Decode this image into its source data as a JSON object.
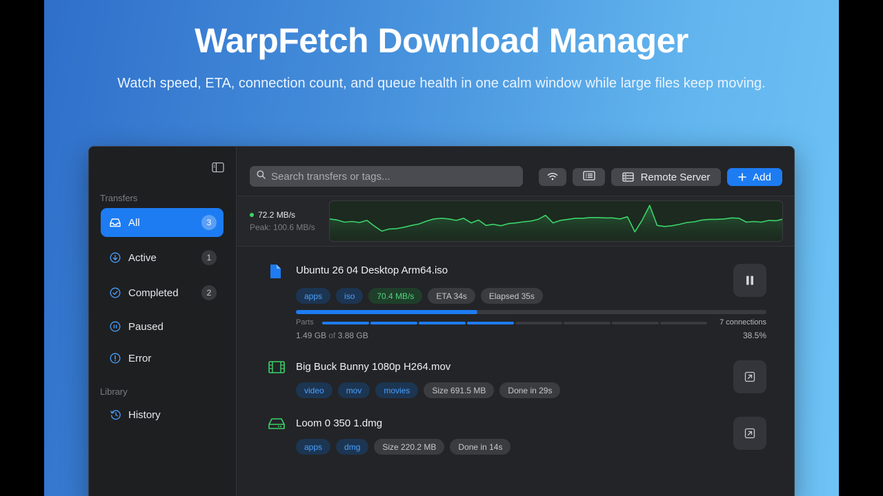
{
  "hero": {
    "title": "WarpFetch Download Manager",
    "subtitle": "Watch speed, ETA, connection count, and queue health in one calm window while large files keep moving."
  },
  "sidebar": {
    "section_transfers": "Transfers",
    "section_library": "Library",
    "items": [
      {
        "label": "All",
        "count": "3",
        "icon": "inbox-icon",
        "selected": true
      },
      {
        "label": "Active",
        "count": "1",
        "icon": "download-circle-icon"
      },
      {
        "label": "Completed",
        "count": "2",
        "icon": "check-circle-icon"
      },
      {
        "label": "Paused",
        "count": "",
        "icon": "pause-circle-icon"
      },
      {
        "label": "Error",
        "count": "",
        "icon": "alert-circle-icon"
      }
    ],
    "library_items": [
      {
        "label": "History",
        "icon": "history-icon"
      }
    ]
  },
  "toolbar": {
    "search_placeholder": "Search transfers or tags...",
    "remote_label": "Remote Server",
    "add_label": "Add"
  },
  "speed": {
    "current": "72.2 MB/s",
    "peak": "Peak: 100.6 MB/s",
    "accent": "#3bd46a",
    "history": [
      58,
      55,
      49,
      51,
      48,
      54,
      38,
      24,
      30,
      31,
      35,
      40,
      44,
      52,
      58,
      60,
      58,
      54,
      60,
      47,
      55,
      40,
      43,
      39,
      45,
      47,
      50,
      52,
      57,
      68,
      47,
      54,
      57,
      60,
      60,
      62,
      62,
      61,
      61,
      58,
      64,
      22,
      55,
      96,
      40,
      37,
      39,
      43,
      48,
      50,
      55,
      57,
      57,
      58,
      61,
      60,
      49,
      51,
      49,
      54,
      53,
      58
    ]
  },
  "transfers": [
    {
      "name": "Ubuntu 26 04 Desktop Arm64.iso",
      "icon": "document-icon",
      "tags": [
        {
          "text": "apps",
          "kind": "blue"
        },
        {
          "text": "iso",
          "kind": "blue"
        },
        {
          "text": "70.4 MB/s",
          "kind": "green"
        },
        {
          "text": "ETA 34s",
          "kind": "gray"
        },
        {
          "text": "Elapsed 35s",
          "kind": "gray"
        }
      ],
      "progress": 0.385,
      "parts_label": "Parts",
      "parts_progress": [
        1,
        1,
        1,
        1,
        0,
        0,
        0,
        0
      ],
      "connections": "7 connections",
      "downloaded": "1.49 GB",
      "of_label": "of",
      "total": "3.88 GB",
      "percent": "38.5%",
      "action": "pause-icon"
    },
    {
      "name": "Big Buck Bunny 1080p H264.mov",
      "icon": "film-icon",
      "tags": [
        {
          "text": "video",
          "kind": "blue"
        },
        {
          "text": "mov",
          "kind": "blue"
        },
        {
          "text": "movies",
          "kind": "blue"
        },
        {
          "text": "Size 691.5 MB",
          "kind": "gray"
        },
        {
          "text": "Done in 29s",
          "kind": "gray"
        }
      ],
      "action": "open-external-icon"
    },
    {
      "name": "Loom 0 350 1.dmg",
      "icon": "drive-icon",
      "tags": [
        {
          "text": "apps",
          "kind": "blue"
        },
        {
          "text": "dmg",
          "kind": "blue"
        },
        {
          "text": "Size 220.2 MB",
          "kind": "gray"
        },
        {
          "text": "Done in 14s",
          "kind": "gray"
        }
      ],
      "action": "open-external-icon"
    }
  ]
}
